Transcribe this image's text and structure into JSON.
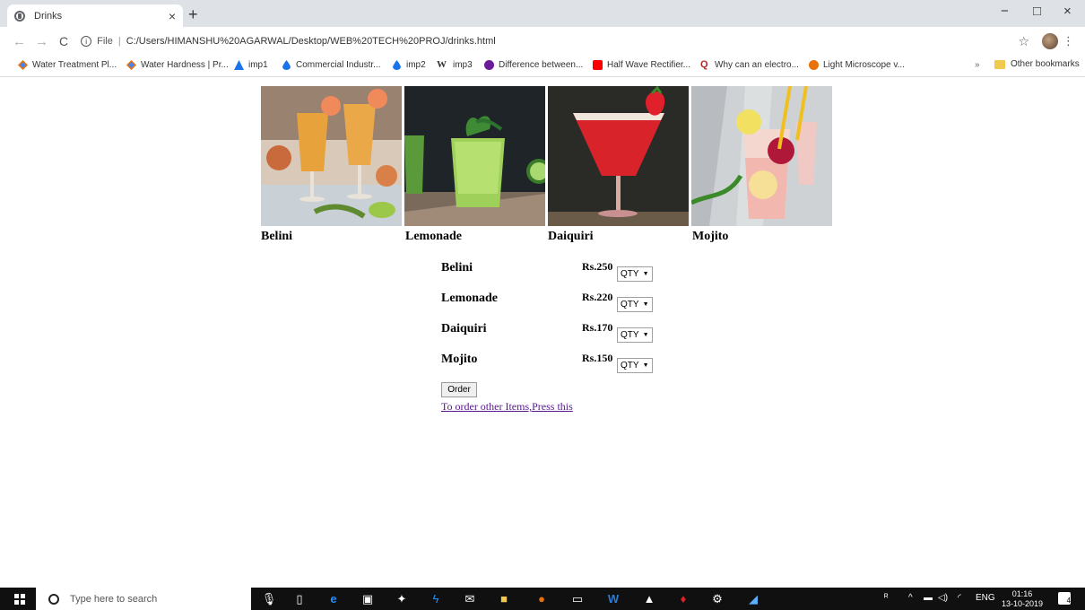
{
  "browser": {
    "tab_title": "Drinks",
    "tab_close": "×",
    "new_tab": "+",
    "url_prefix": "File",
    "url": "C:/Users/HIMANSHU%20AGARWAL/Desktop/WEB%20TECH%20PROJ/drinks.html",
    "window_controls": [
      "−",
      "□",
      "×"
    ]
  },
  "bookmarks": {
    "items": [
      {
        "label": "Water Treatment Pl...",
        "icon": "diamond-icon",
        "color": "#e8710a"
      },
      {
        "label": "Water Hardness | Pr...",
        "icon": "diamond-icon",
        "color": "#e8710a"
      },
      {
        "label": "imp1",
        "icon": "triangle-icon",
        "color": "#1a73e8"
      },
      {
        "label": "Commercial Industr...",
        "icon": "drop-icon",
        "color": "#1a73e8"
      },
      {
        "label": "imp2",
        "icon": "drop-icon",
        "color": "#1a73e8"
      },
      {
        "label": "imp3",
        "icon": "wikipedia-icon",
        "color": "#000000"
      },
      {
        "label": "Difference between...",
        "icon": "circle-icon",
        "color": "#6a1b9a"
      },
      {
        "label": "Half Wave Rectifier...",
        "icon": "youtube-icon",
        "color": "#ff0000"
      },
      {
        "label": "Why can an electro...",
        "icon": "quora-icon",
        "color": "#b92b27"
      },
      {
        "label": "Light Microscope v...",
        "icon": "circle-icon",
        "color": "#e8710a"
      }
    ],
    "more": "»",
    "other": "Other bookmarks"
  },
  "gallery": {
    "drinks": [
      {
        "caption": "Belini"
      },
      {
        "caption": "Lemonade"
      },
      {
        "caption": "Daiquiri"
      },
      {
        "caption": "Mojito"
      }
    ]
  },
  "menu": {
    "items": [
      {
        "name": "Belini",
        "price": "Rs.250",
        "qty": "QTY"
      },
      {
        "name": "Lemonade",
        "price": "Rs.220",
        "qty": "QTY"
      },
      {
        "name": "Daiquiri",
        "price": "Rs.170",
        "qty": "QTY"
      },
      {
        "name": "Mojito",
        "price": "Rs.150",
        "qty": "QTY"
      }
    ],
    "order_button": "Order",
    "other_link": "To order other Items,Press this"
  },
  "taskbar": {
    "search_placeholder": "Type here to search",
    "tray_lang": "ENG",
    "time": "01:16",
    "date": "13-10-2019",
    "notification_count": "4"
  }
}
